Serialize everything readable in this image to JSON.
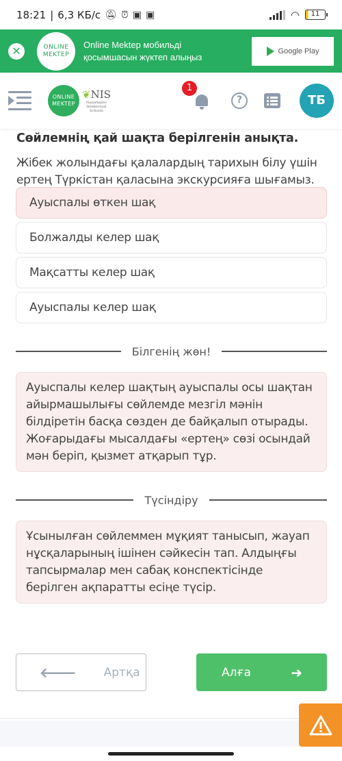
{
  "status_bar": {
    "time": "18:21",
    "network_speed": "6,3 КБ/с",
    "icons": [
      "bell-off-icon",
      "alarm-icon",
      "app-icon",
      "app-icon"
    ],
    "battery_level": "11"
  },
  "promo_banner": {
    "logo_line1": "ONLINE",
    "logo_line2": "MEKTEP",
    "text_line1": "Online Mektep мобильді",
    "text_line2": "қосымшасын жүктеп алыңыз",
    "store_label": "Google Play",
    "close_icon": "close-circle-icon"
  },
  "header": {
    "logo_line1": "ONLINE",
    "logo_line2": "MEKTEP",
    "nis_title": "NIS",
    "nis_sub": [
      "Nazarbayev",
      "Intellectual",
      "Schools"
    ],
    "notification_count": "1",
    "help_symbol": "?",
    "avatar_initials": "ТБ"
  },
  "question": {
    "title": "Сөйлемнің қай шақта берілгенін анықта.",
    "text": "Жібек жолындағы қалалардың тарихын білу үшін ертең Түркістан қаласына экскурсияға шығамыз.",
    "options": [
      {
        "label": "Ауыспалы өткен шақ",
        "state": "wrong"
      },
      {
        "label": "Болжалды келер шақ",
        "state": "default"
      },
      {
        "label": "Мақсатты келер шақ",
        "state": "default"
      },
      {
        "label": "Ауыспалы келер шақ",
        "state": "default"
      }
    ]
  },
  "feedback": {
    "heading": "Білгенің жөн!",
    "text": "Ауыспалы келер шақтың ауыспалы осы шақтан айырмашылығы сөйлемде мезгіл мәнін білдіретін басқа сөзден де байқалып отырады. Жоғарыдағы мысалдағы «ертең» сөзі осындай мән беріп, қызмет атқарып тұр."
  },
  "explanation": {
    "heading": "Түсіндіру",
    "text": "Ұсынылған сөйлеммен мұқият танысып, жауап нұсқаларының ішінен сәйкесін тап. Алдыңғы тапсырмалар мен сабақ конспектісінде берілген ақпаратты есіңе түсір."
  },
  "navigation": {
    "back_label": "Артқа",
    "next_label": "Алға",
    "back_arrow": "🡐",
    "next_arrow": "➜"
  },
  "colors": {
    "brand_green": "#27ae60",
    "next_button": "#4fc06a",
    "wrong_option_bg": "#fbeaea",
    "avatar": "#23a3b3",
    "badge": "#e81c24",
    "warning": "#f39226"
  }
}
